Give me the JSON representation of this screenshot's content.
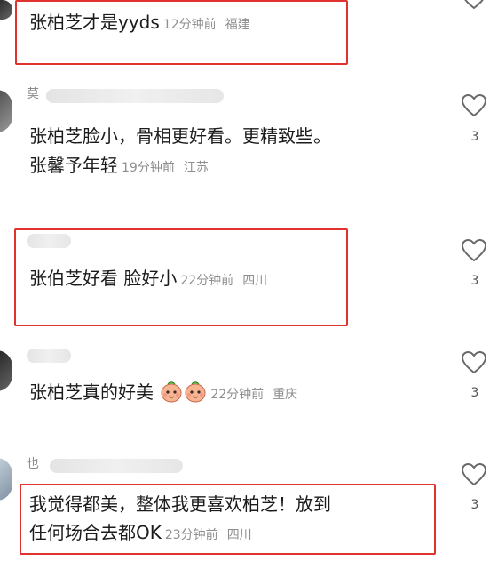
{
  "comments": [
    {
      "id": "c1",
      "username": "",
      "text": "张柏芝才是yyds",
      "time": "12分钟前",
      "location": "福建",
      "likes": ""
    },
    {
      "id": "c2",
      "username": "莫",
      "text_line1": "张柏芝脸小，骨相更好看。更精致些。",
      "text_line2": "张馨予年轻",
      "time": "19分钟前",
      "location": "江苏",
      "likes": "3"
    },
    {
      "id": "c3",
      "username": "",
      "text": "张伯芝好看 脸好小",
      "time": "22分钟前",
      "location": "四川",
      "likes": "3"
    },
    {
      "id": "c4",
      "username": "",
      "text": "张柏芝真的好美",
      "emojis": [
        "peach-face-emoji",
        "peach-face-emoji"
      ],
      "time": "22分钟前",
      "location": "重庆",
      "likes": "3"
    },
    {
      "id": "c5",
      "username": "也",
      "text_line1": "我觉得都美，整体我更喜欢柏芝！放到",
      "text_line2": "任何场合去都OK",
      "time": "23分钟前",
      "location": "四川",
      "likes": "3"
    }
  ],
  "colors": {
    "highlight_box": "#e0322e",
    "meta_gray": "#8e8e8e"
  },
  "icons": {
    "like": "heart-outline-icon"
  }
}
